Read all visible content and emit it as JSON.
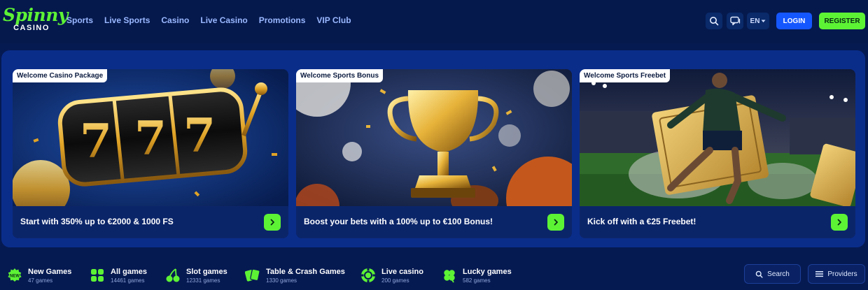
{
  "logo": {
    "word": "Spinny",
    "sub": "CASINO"
  },
  "nav": [
    "Sports",
    "Live Sports",
    "Casino",
    "Live Casino",
    "Promotions",
    "VIP Club"
  ],
  "header": {
    "language": "EN",
    "login_label": "LOGIN",
    "register_label": "REGISTER",
    "icons": [
      "search-icon",
      "chat-icon",
      "chevron-down-icon"
    ]
  },
  "promos": [
    {
      "tag": "Welcome Casino Package",
      "text": "Start with 350% up to €2000 & 1000 FS"
    },
    {
      "tag": "Welcome Sports Bonus",
      "text": "Boost your bets with a 100% up to €100 Bonus!"
    },
    {
      "tag": "Welcome Sports Freebet",
      "text": "Kick off with a €25 Freebet!"
    }
  ],
  "categories": [
    {
      "title": "New Games",
      "count": "47 games",
      "icon": "new-badge-icon"
    },
    {
      "title": "All games",
      "count": "14461 games",
      "icon": "grid-icon"
    },
    {
      "title": "Slot games",
      "count": "12331 games",
      "icon": "cherries-icon"
    },
    {
      "title": "Table & Crash Games",
      "count": "1330 games",
      "icon": "cards-icon"
    },
    {
      "title": "Live casino",
      "count": "200 games",
      "icon": "chip-icon"
    },
    {
      "title": "Lucky games",
      "count": "582 games",
      "icon": "clover-icon"
    }
  ],
  "tools": {
    "search_label": "Search",
    "providers_label": "Providers"
  },
  "colors": {
    "accent_green": "#5df335",
    "primary_blue": "#1557ff",
    "background": "#061a52"
  }
}
